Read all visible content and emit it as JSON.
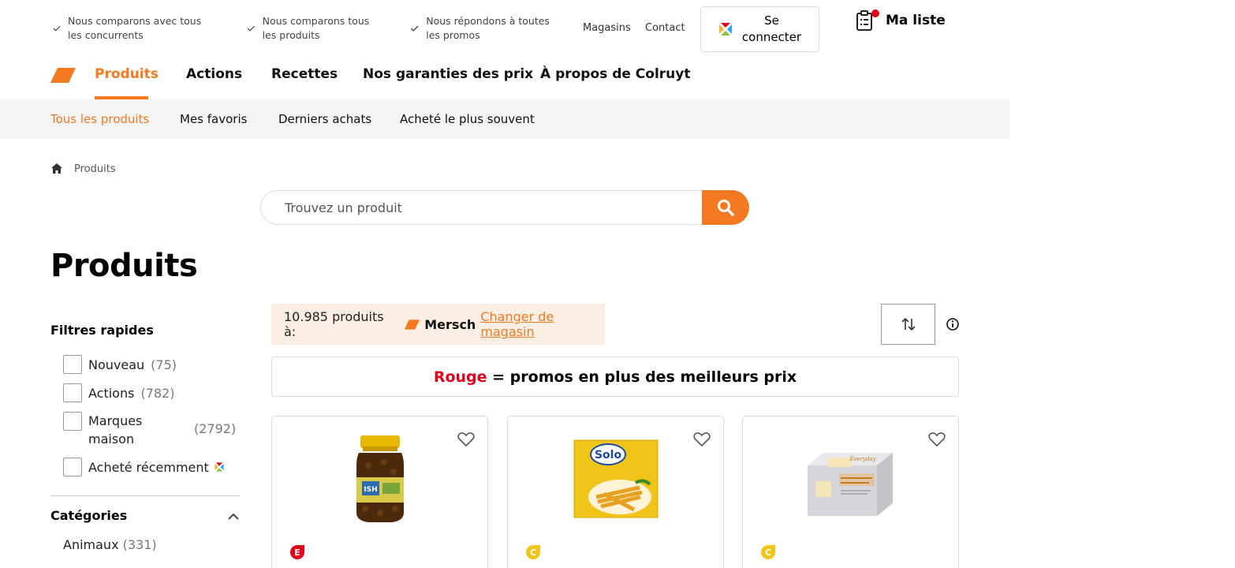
{
  "usps": [
    "Nous comparons avec tous les concurrents",
    "Nous comparons tous les produits",
    "Nous répondons à toutes les promos"
  ],
  "toplinks": {
    "stores": "Magasins",
    "contact": "Contact"
  },
  "login": {
    "label": "Se connecter"
  },
  "mylist": {
    "label": "Ma liste"
  },
  "mainnav": [
    "Produits",
    "Actions",
    "Recettes",
    "Nos garanties des prix",
    "À propos de Colruyt"
  ],
  "subnav": [
    "Tous les produits",
    "Mes favoris",
    "Derniers achats",
    "Acheté le plus souvent"
  ],
  "breadcrumb": {
    "current": "Produits"
  },
  "search": {
    "placeholder": "Trouvez un produit"
  },
  "page_title": "Produits",
  "filters": {
    "title": "Filtres rapides",
    "items": [
      {
        "label": "Nouveau",
        "count": "(75)"
      },
      {
        "label": "Actions",
        "count": "(782)"
      },
      {
        "label": "Marques maison",
        "count": "(2792)"
      },
      {
        "label": "Acheté récemment",
        "count": ""
      }
    ]
  },
  "categories": {
    "title": "Catégories",
    "items": [
      {
        "label": "Animaux",
        "count": "(331)"
      }
    ]
  },
  "store": {
    "count_text": "10.985 produits à:",
    "name": "Mersch",
    "change_label": "Changer de magasin"
  },
  "promo": {
    "red_word": "Rouge",
    "rest": " = promos en plus des meilleurs prix"
  },
  "colors": {
    "accent": "#f47920",
    "promo_red": "#e2001a",
    "subnav_bg": "#f4f4f4",
    "store_bg": "#fdeee4"
  },
  "products": [
    {
      "image": "capers-jar-image",
      "badge": "E-label-icon"
    },
    {
      "image": "solo-box-image",
      "badge": "C-label-icon"
    },
    {
      "image": "everyday-butter-image",
      "badge": "C-label-icon"
    }
  ]
}
